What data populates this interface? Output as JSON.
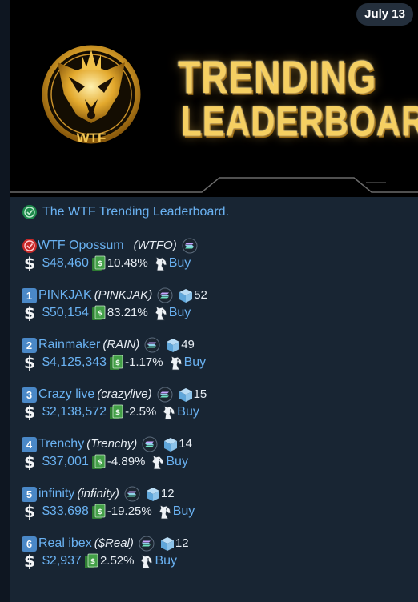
{
  "header": {
    "date": "July 13"
  },
  "banner": {
    "logo_text": "WTF",
    "title_line1": "TRENDING",
    "title_line2": "LEADERBOARD"
  },
  "intro": {
    "text": "The WTF Trending Leaderboard."
  },
  "featured": {
    "name": "WTF Opossum",
    "ticker": "(WTFO)",
    "mcap": "$48,460",
    "change": "10.48%",
    "buy_label": "Buy"
  },
  "entries": [
    {
      "rank": "1",
      "name": "PINKJAK",
      "ticker": "(PINKJAK)",
      "score": "52",
      "mcap": "$50,154",
      "change": "83.21%",
      "buy_label": "Buy"
    },
    {
      "rank": "2",
      "name": "Rainmaker",
      "ticker": "(RAIN)",
      "score": "49",
      "mcap": "$4,125,343",
      "change": "-1.17%",
      "buy_label": "Buy"
    },
    {
      "rank": "3",
      "name": "Crazy live",
      "ticker": "(crazylive)",
      "score": "15",
      "mcap": "$2,138,572",
      "change": "-2.5%",
      "buy_label": "Buy"
    },
    {
      "rank": "4",
      "name": "Trenchy",
      "ticker": "(Trenchy)",
      "score": "14",
      "mcap": "$37,001",
      "change": "-4.89%",
      "buy_label": "Buy"
    },
    {
      "rank": "5",
      "name": "infinity",
      "ticker": "(infinity)",
      "score": "12",
      "mcap": "$33,698",
      "change": "-19.25%",
      "buy_label": "Buy"
    },
    {
      "rank": "6",
      "name": "Real ibex",
      "ticker": "($Real)",
      "score": "12",
      "mcap": "$2,937",
      "change": "2.52%",
      "buy_label": "Buy"
    }
  ],
  "icons": {
    "intro": "green-seal-icon",
    "featured": "red-seal-icon",
    "chain": "solana-icon",
    "score": "box-icon",
    "mcap": "dollar-icon",
    "change": "money-stack-icon",
    "buy": "horse-icon"
  },
  "colors": {
    "link": "#6ab2f2",
    "badge": "#4a88c7",
    "gold": "#f5cf62",
    "background": "#182533"
  }
}
